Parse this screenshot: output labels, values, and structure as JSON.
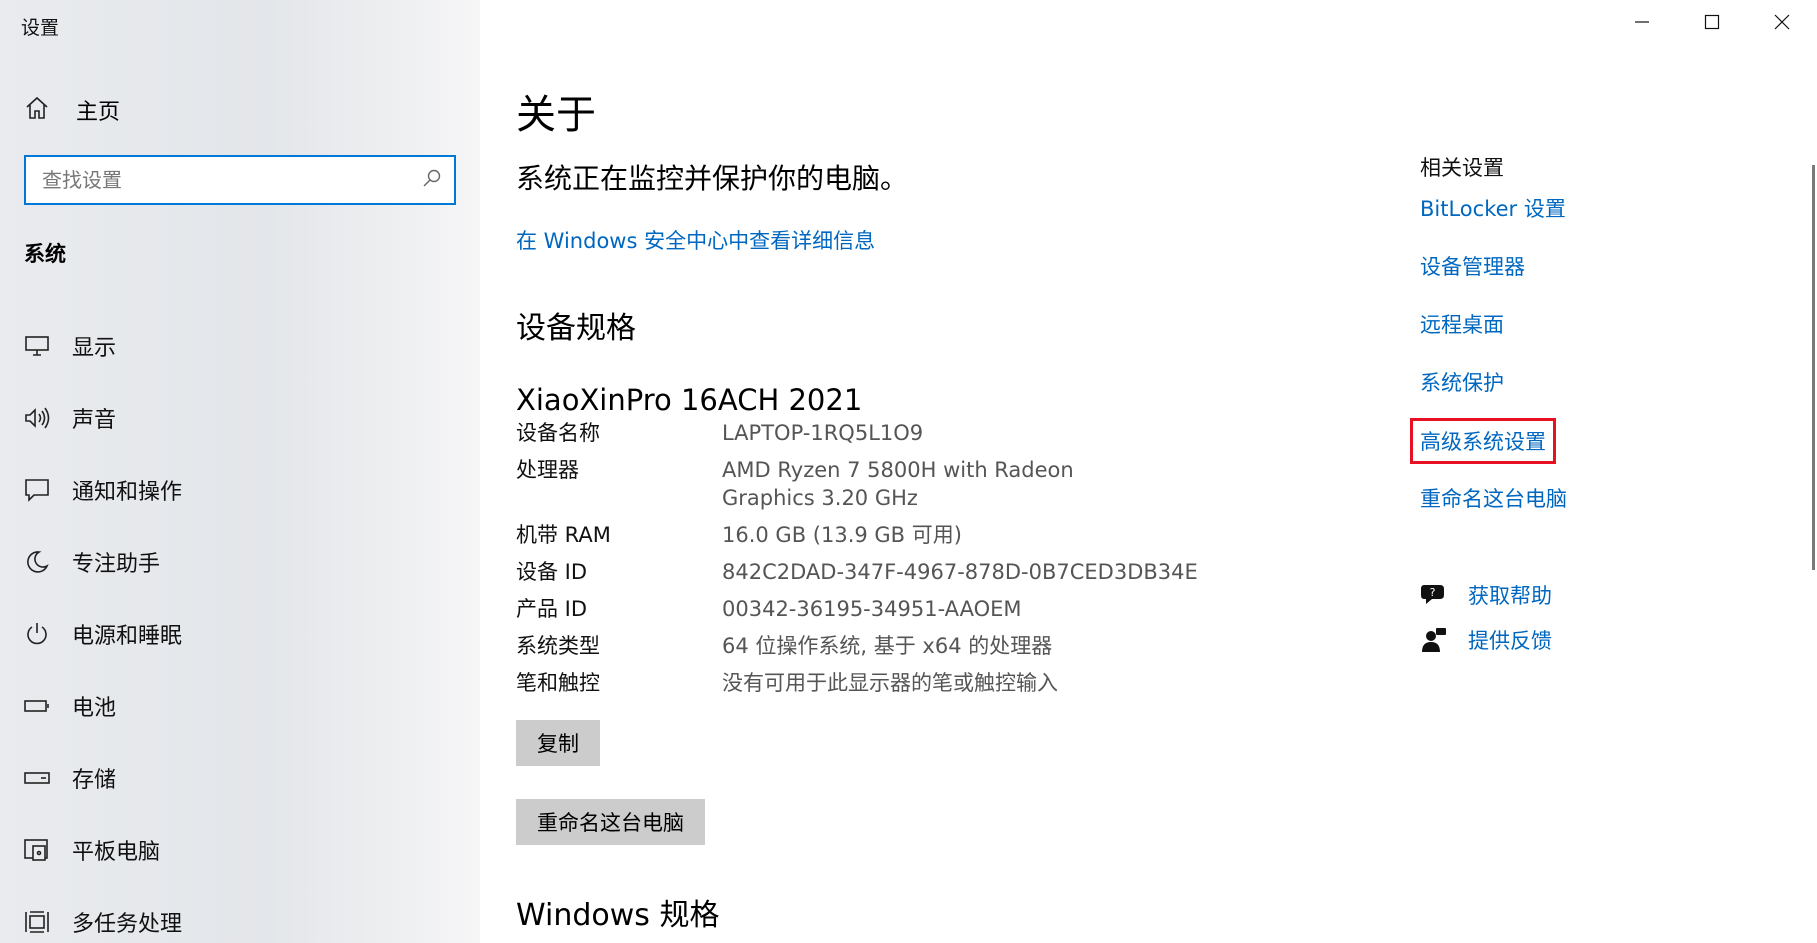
{
  "window": {
    "title": "设置"
  },
  "sidebar": {
    "home_label": "主页",
    "search_placeholder": "查找设置",
    "section_title": "系统",
    "items": [
      {
        "label": "显示",
        "icon": "display-icon"
      },
      {
        "label": "声音",
        "icon": "speaker-icon"
      },
      {
        "label": "通知和操作",
        "icon": "notification-icon"
      },
      {
        "label": "专注助手",
        "icon": "moon-icon"
      },
      {
        "label": "电源和睡眠",
        "icon": "power-icon"
      },
      {
        "label": "电池",
        "icon": "battery-icon"
      },
      {
        "label": "存储",
        "icon": "storage-icon"
      },
      {
        "label": "平板电脑",
        "icon": "tablet-icon"
      },
      {
        "label": "多任务处理",
        "icon": "multitask-icon"
      }
    ]
  },
  "main": {
    "page_title": "关于",
    "status_text": "系统正在监控并保护你的电脑。",
    "security_link": "在 Windows 安全中心中查看详细信息",
    "device_specs_title": "设备规格",
    "device_model": "XiaoXinPro 16ACH 2021",
    "specs": [
      {
        "key": "设备名称",
        "value": "LAPTOP-1RQ5L1O9"
      },
      {
        "key": "处理器",
        "value": "AMD Ryzen 7 5800H with Radeon Graphics 3.20 GHz"
      },
      {
        "key": "机带 RAM",
        "value": "16.0 GB (13.9 GB 可用)"
      },
      {
        "key": "设备 ID",
        "value": "842C2DAD-347F-4967-878D-0B7CED3DB34E"
      },
      {
        "key": "产品 ID",
        "value": "00342-36195-34951-AAOEM"
      },
      {
        "key": "系统类型",
        "value": "64 位操作系统, 基于 x64 的处理器"
      },
      {
        "key": "笔和触控",
        "value": "没有可用于此显示器的笔或触控输入"
      }
    ],
    "copy_button": "复制",
    "rename_button": "重命名这台电脑",
    "windows_specs_title": "Windows 规格"
  },
  "related": {
    "title": "相关设置",
    "links": [
      "BitLocker 设置",
      "设备管理器",
      "远程桌面",
      "系统保护",
      "高级系统设置",
      "重命名这台电脑"
    ],
    "help_label": "获取帮助",
    "feedback_label": "提供反馈"
  },
  "colors": {
    "accent": "#0078d7",
    "link": "#0067c0",
    "highlight_border": "#e81123"
  }
}
